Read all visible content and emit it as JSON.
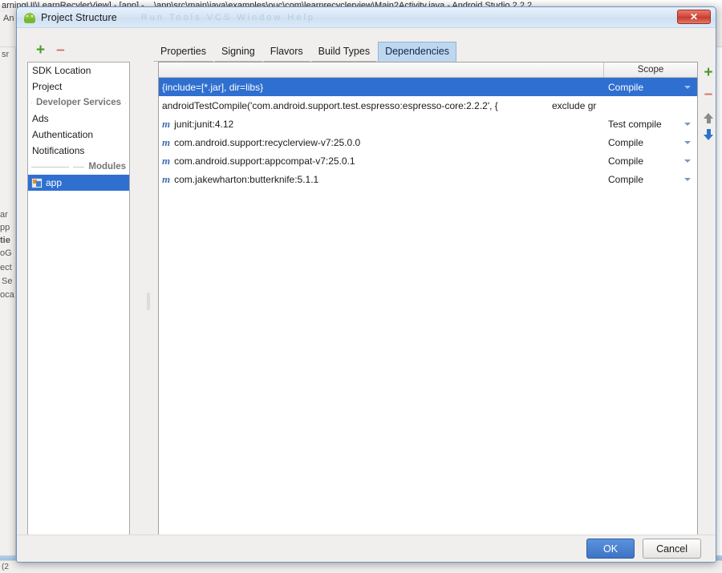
{
  "ide": {
    "title": "arningUI\\LearnRecylerView] - [app] - ...\\app\\src\\main\\java\\examples\\ouc\\com\\learnrecyclerview\\Main2Activity.java - Android Studio 2.2.2",
    "menu_ghost": "An",
    "ghost_left": [
      "sr",
      "ar",
      "pp",
      "tie",
      "oG",
      "ect",
      "Se",
      "oca"
    ],
    "status": "(2"
  },
  "dialog": {
    "title": "Project Structure",
    "icon": "android-robot-icon",
    "ghost_menu": "Run  Tools  VCS  Window  Help",
    "close_label": "✕"
  },
  "sidebar": {
    "toolbar": {
      "add_label": "+",
      "remove_label": "–"
    },
    "items": [
      {
        "type": "item",
        "label": "SDK Location",
        "selected": false
      },
      {
        "type": "item",
        "label": "Project",
        "selected": false
      },
      {
        "type": "group",
        "label": "Developer Services"
      },
      {
        "type": "item",
        "label": "Ads",
        "selected": false
      },
      {
        "type": "item",
        "label": "Authentication",
        "selected": false
      },
      {
        "type": "item",
        "label": "Notifications",
        "selected": false
      },
      {
        "type": "group",
        "label": "Modules"
      },
      {
        "type": "module",
        "label": "app",
        "selected": true
      }
    ]
  },
  "tabs": [
    {
      "label": "Properties",
      "active": false
    },
    {
      "label": "Signing",
      "active": false
    },
    {
      "label": "Flavors",
      "active": false
    },
    {
      "label": "Build Types",
      "active": false
    },
    {
      "label": "Dependencies",
      "active": true
    }
  ],
  "table": {
    "columns": [
      "",
      "Scope"
    ],
    "rows": [
      {
        "icon": "",
        "name": "{include=[*.jar], dir=libs}",
        "extra": "",
        "scope": "Compile",
        "has_caret": true,
        "selected": true
      },
      {
        "icon": "",
        "name": "androidTestCompile('com.android.support.test.espresso:espresso-core:2.2.2', {",
        "extra": "exclude gr",
        "scope": "",
        "has_caret": false,
        "selected": false
      },
      {
        "icon": "m",
        "name": "junit:junit:4.12",
        "extra": "",
        "scope": "Test compile",
        "has_caret": true,
        "selected": false
      },
      {
        "icon": "m",
        "name": "com.android.support:recyclerview-v7:25.0.0",
        "extra": "",
        "scope": "Compile",
        "has_caret": true,
        "selected": false
      },
      {
        "icon": "m",
        "name": "com.android.support:appcompat-v7:25.0.1",
        "extra": "",
        "scope": "Compile",
        "has_caret": true,
        "selected": false
      },
      {
        "icon": "m",
        "name": "com.jakewharton:butterknife:5.1.1",
        "extra": "",
        "scope": "Compile",
        "has_caret": true,
        "selected": false
      }
    ]
  },
  "right_toolbar": {
    "add_label": "+",
    "remove_label": "–",
    "move_up": "move-up",
    "move_down": "move-down"
  },
  "footer": {
    "ok_label": "OK",
    "cancel_label": "Cancel"
  },
  "colors": {
    "selection": "#2f6fd0",
    "tab_active": "#bfd6ef",
    "ok_button": "#4a82d0",
    "add_icon": "#4c9a2a",
    "remove_icon": "#d4736a"
  }
}
